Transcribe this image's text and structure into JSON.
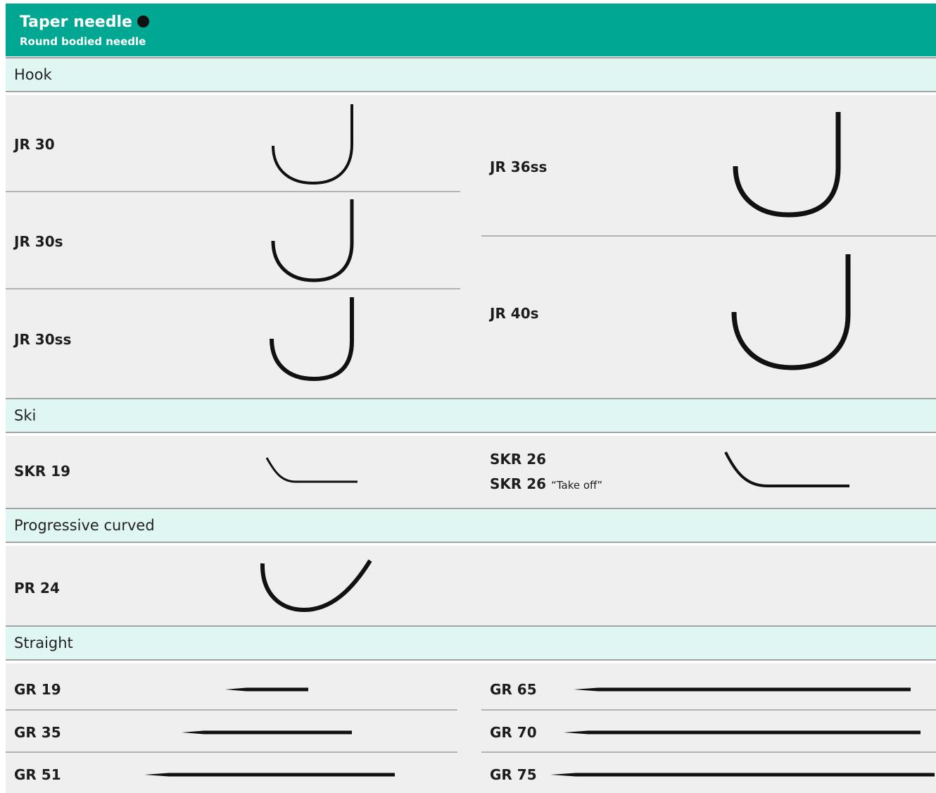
{
  "header": {
    "title": "Taper needle",
    "subtitle": "Round bodied needle"
  },
  "sections": {
    "hook": "Hook",
    "ski": "Ski",
    "progressive": "Progressive curved",
    "straight": "Straight"
  },
  "hook_items": {
    "jr30": "JR 30",
    "jr30s": "JR 30s",
    "jr30ss": "JR 30ss",
    "jr36ss": "JR 36ss",
    "jr40s": "JR 40s"
  },
  "ski_items": {
    "skr19": "SKR 19",
    "skr26": "SKR 26",
    "skr26_take_off": "SKR 26",
    "take_off_note": "“Take off”"
  },
  "progressive_items": {
    "pr24": "PR 24"
  },
  "straight_items": {
    "gr19": "GR 19",
    "gr35": "GR 35",
    "gr51": "GR 51",
    "gr65": "GR 65",
    "gr70": "GR 70",
    "gr75": "GR 75"
  },
  "colors": {
    "header": "#00a893",
    "section_band": "#e0f6f3",
    "body": "#efefef",
    "divider": "#b3b3b3",
    "needle": "#111111"
  }
}
